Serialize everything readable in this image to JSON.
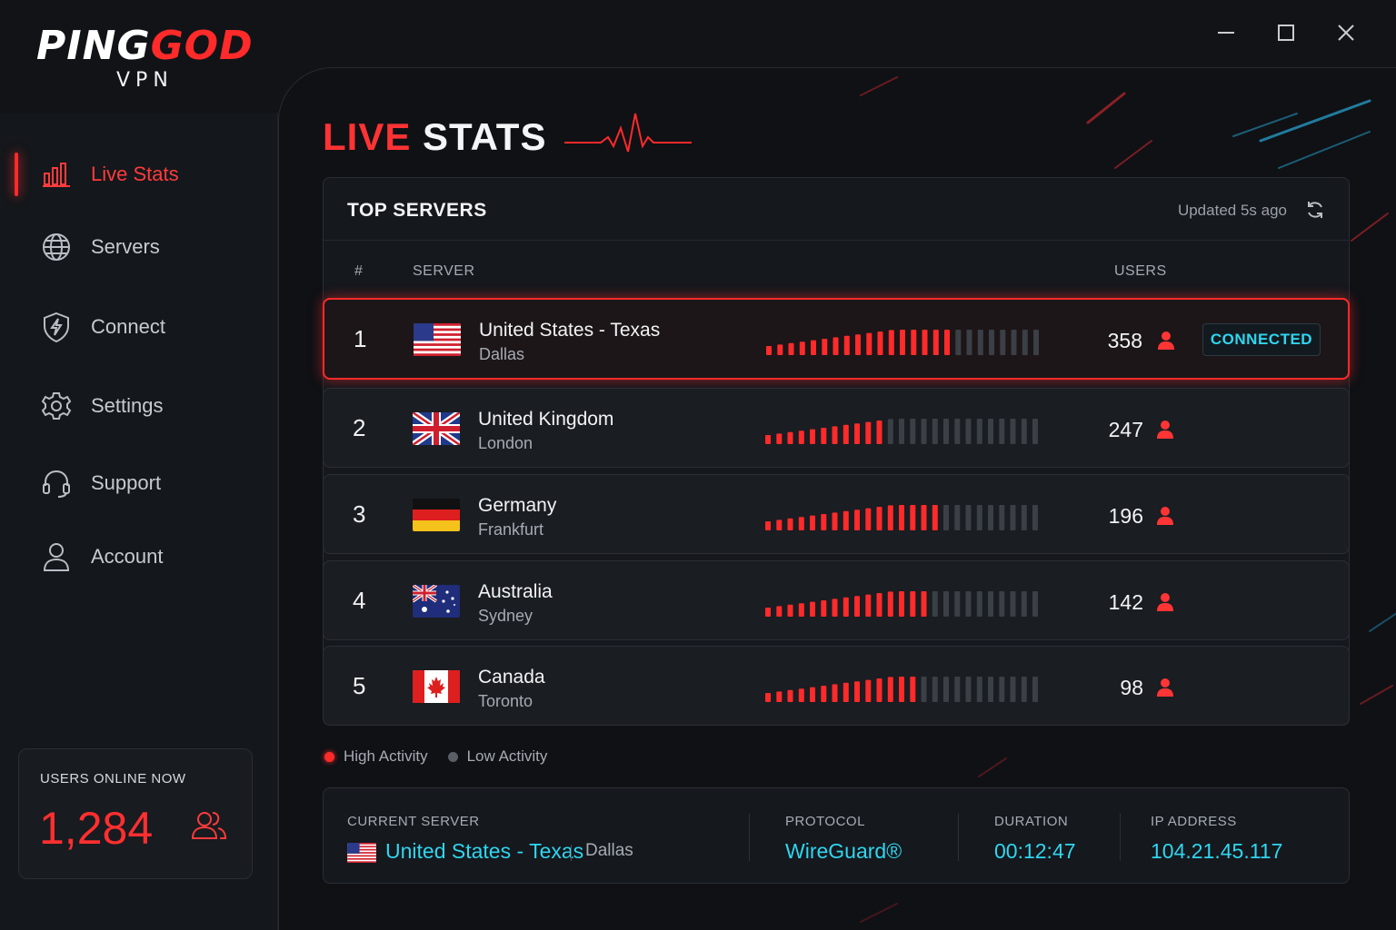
{
  "app": {
    "brand_left": "PING",
    "brand_right": "GOD",
    "brand_sub": "VPN"
  },
  "window_controls": [
    "minimize-icon",
    "maximize-icon",
    "close-icon"
  ],
  "sidebar": {
    "items": [
      {
        "label": "Live Stats",
        "icon": "bar-chart-icon",
        "active": true
      },
      {
        "label": "Servers",
        "icon": "globe-icon",
        "active": false
      },
      {
        "label": "Connect",
        "icon": "shield-bolt-icon",
        "active": false
      },
      {
        "label": "Settings",
        "icon": "gear-icon",
        "active": false
      },
      {
        "label": "Support",
        "icon": "headset-icon",
        "active": false
      },
      {
        "label": "Account",
        "icon": "user-icon",
        "active": false
      }
    ],
    "online": {
      "title": "USERS ONLINE NOW",
      "count": "1,284"
    }
  },
  "main": {
    "title_red": "LIVE",
    "title_white": "STATS",
    "top_servers": {
      "title": "TOP SERVERS",
      "updated": "Updated 5s ago",
      "columns": {
        "rank": "#",
        "server": "SERVER",
        "users": "USERS"
      },
      "rows": [
        {
          "rank": "1",
          "country": "United States - Texas",
          "city": "Dallas",
          "flag": "us",
          "users": "358",
          "activity": 0.68,
          "status": "CONNECTED",
          "selected": true
        },
        {
          "rank": "2",
          "country": "United Kingdom",
          "city": "London",
          "flag": "uk",
          "users": "247",
          "activity": 0.42,
          "status": "",
          "selected": false
        },
        {
          "rank": "3",
          "country": "Germany",
          "city": "Frankfurt",
          "flag": "de",
          "users": "196",
          "activity": 0.64,
          "status": "",
          "selected": false
        },
        {
          "rank": "4",
          "country": "Australia",
          "city": "Sydney",
          "flag": "au",
          "users": "142",
          "activity": 0.6,
          "status": "",
          "selected": false
        },
        {
          "rank": "5",
          "country": "Canada",
          "city": "Toronto",
          "flag": "ca",
          "users": "98",
          "activity": 0.58,
          "status": "",
          "selected": false
        }
      ]
    },
    "legend": {
      "high": "High Activity",
      "low": "Low Activity"
    },
    "current": {
      "server_label": "CURRENT SERVER",
      "server_value": "United States - Texas",
      "server_city": "Dallas",
      "protocol_label": "PROTOCOL",
      "protocol_value": "WireGuard®",
      "duration_label": "DURATION",
      "duration_value": "00:12:47",
      "ip_label": "IP ADDRESS",
      "ip_value": "104.21.45.117"
    }
  },
  "colors": {
    "accent_red": "#ff2a2a",
    "accent_cyan": "#2fd6f0",
    "inactive_bar": "#3b3f46"
  }
}
